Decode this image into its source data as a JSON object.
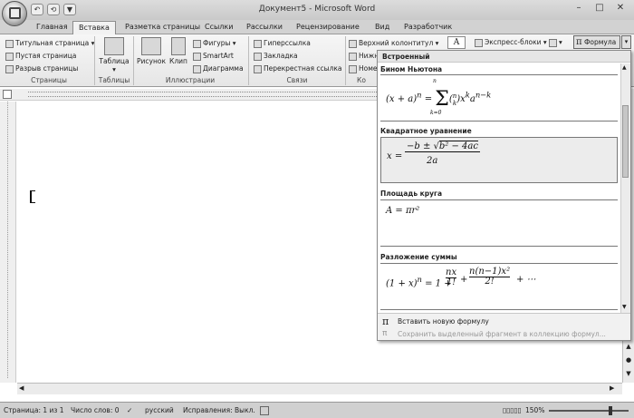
{
  "window": {
    "title": "Документ5 - Microsoft Word"
  },
  "qat": {
    "undo": "↶",
    "save": "⟲",
    "print": "▼"
  },
  "tabs": [
    "Главная",
    "Вставка",
    "Разметка страницы",
    "Ссылки",
    "Рассылки",
    "Рецензирование",
    "Вид",
    "Разработчик"
  ],
  "ribbon": {
    "pages": {
      "title_page": "Титульная страница",
      "blank_page": "Пустая страница",
      "page_break": "Разрыв страницы",
      "group": "Страницы"
    },
    "tables": {
      "table": "Таблица",
      "group": "Таблицы"
    },
    "illustrations": {
      "picture": "Рисунок",
      "clip": "Клип",
      "shapes": "Фигуры",
      "smartart": "SmartArt",
      "chart": "Диаграмма",
      "group": "Иллюстрации"
    },
    "links": {
      "hyperlink": "Гиперссылка",
      "bookmark": "Закладка",
      "cross_ref": "Перекрестная ссылка",
      "group": "Связи"
    },
    "headerfooter": {
      "header": "Верхний колонтитул",
      "footer": "Нижн",
      "page_num": "Номе",
      "group": "Ко"
    },
    "text": {
      "textbox": "A",
      "express": "Экспресс-блоки"
    },
    "symbols": {
      "pi": "π",
      "formula": "Формула"
    }
  },
  "gallery": {
    "header": "Встроенный",
    "items": [
      {
        "title": "Бином Ньютона"
      },
      {
        "title": "Квадратное уравнение"
      },
      {
        "title": "Площадь круга",
        "eq": "A = πr²"
      },
      {
        "title": "Разложение суммы"
      }
    ],
    "insert_new": "Вставить новую формулу",
    "save_selection": "Сохранить выделенный фрагмент в коллекцию формул..."
  },
  "status": {
    "page": "Страница: 1 из 1",
    "words": "Число слов: 0",
    "lang": "русский",
    "track": "Исправления: Выкл.",
    "zoom": "150%"
  }
}
